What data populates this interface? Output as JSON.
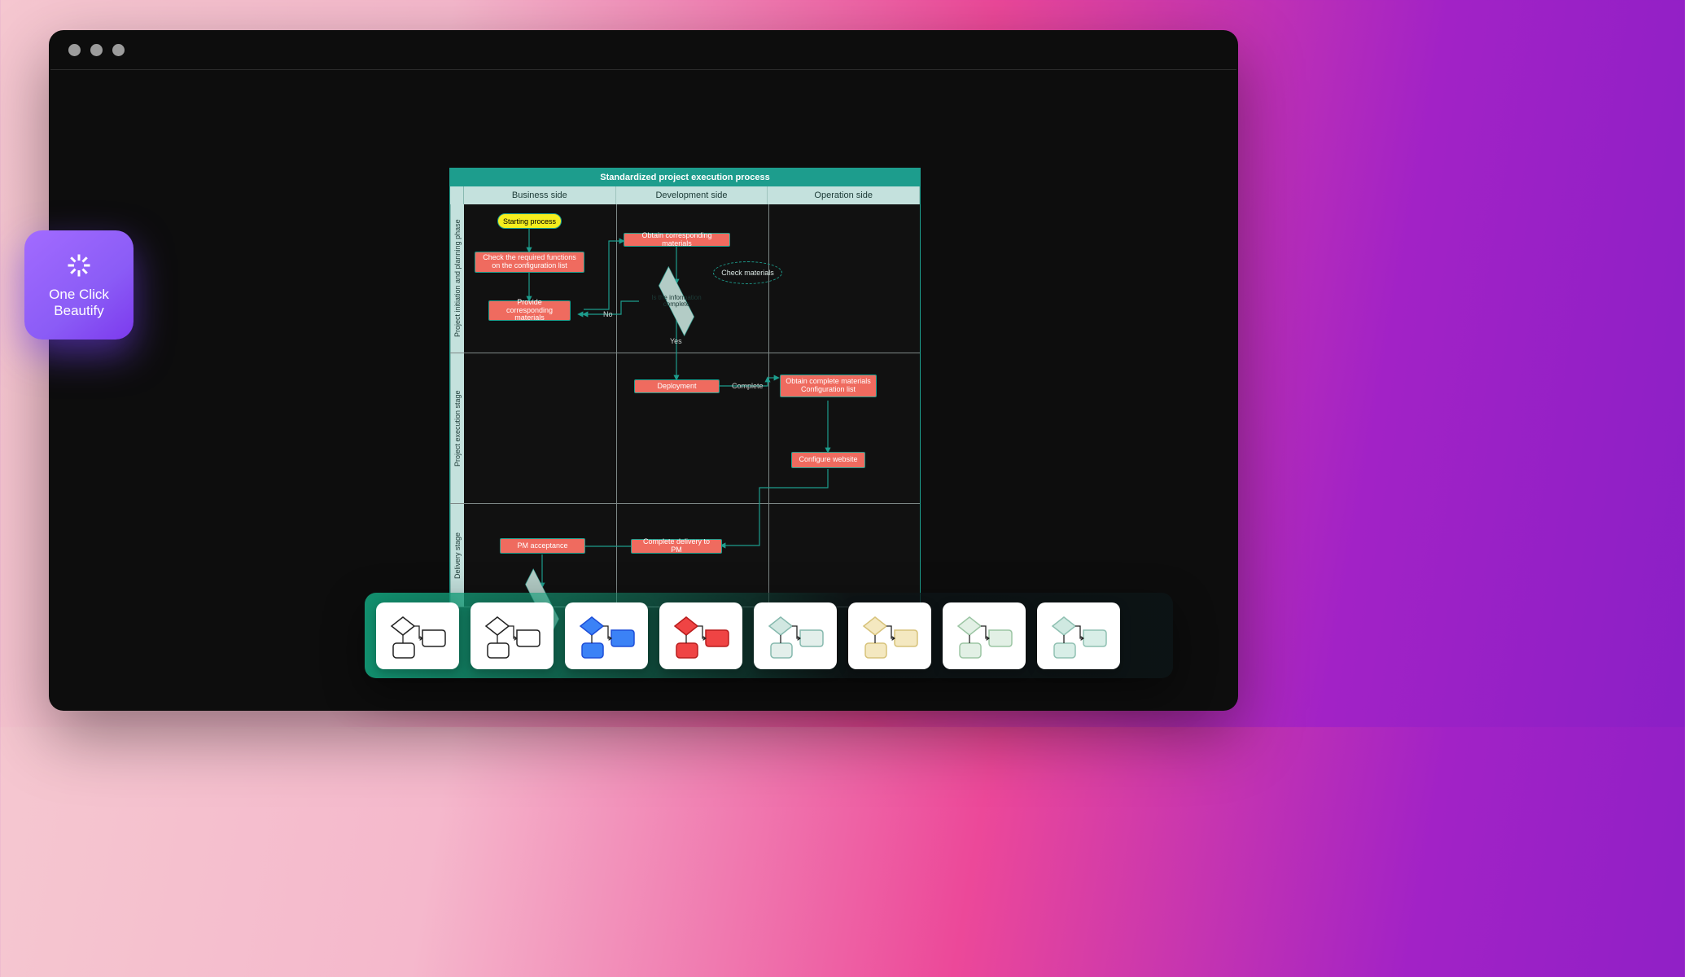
{
  "badge": {
    "line1": "One Click",
    "line2": "Beautify"
  },
  "chart": {
    "title": "Standardized project execution process",
    "columns": [
      "Business side",
      "Development side",
      "Operation side"
    ],
    "lanes": [
      "Project initiation and planning phase",
      "Project execution stage",
      "Delivery stage"
    ],
    "nodes": {
      "start": "Starting process",
      "check_funcs": "Check the required functions on the configuration list",
      "provide_materials": "Provide corresponding materials",
      "obtain_materials": "Obtain corresponding materials",
      "decision": "Is the information complete",
      "check_materials": "Check materials",
      "deployment": "Deployment",
      "obtain_complete": "Obtain complete materials Configuration list",
      "configure_site": "Configure website",
      "complete_delivery": "Complete delivery to PM",
      "pm_acceptance": "PM acceptance"
    },
    "edges": {
      "no": "No",
      "yes": "Yes",
      "complete": "Complete"
    }
  },
  "styles": [
    {
      "name": "style-outline-white",
      "diamond_fill": "#ffffff",
      "diamond_stroke": "#222",
      "box_fill": "#ffffff",
      "box_stroke": "#222"
    },
    {
      "name": "style-outline-black",
      "diamond_fill": "#ffffff",
      "diamond_stroke": "#222",
      "box_fill": "#ffffff",
      "box_stroke": "#222"
    },
    {
      "name": "style-blue",
      "diamond_fill": "#3b82f6",
      "diamond_stroke": "#1d4ed8",
      "box_fill": "#3b82f6",
      "box_stroke": "#1d4ed8"
    },
    {
      "name": "style-red",
      "diamond_fill": "#ef4444",
      "diamond_stroke": "#b91c1c",
      "box_fill": "#ef4444",
      "box_stroke": "#b91c1c"
    },
    {
      "name": "style-mint",
      "diamond_fill": "#d1e7e1",
      "diamond_stroke": "#86b9ae",
      "box_fill": "#e3efeb",
      "box_stroke": "#86b9ae"
    },
    {
      "name": "style-cream",
      "diamond_fill": "#f4e8c0",
      "diamond_stroke": "#d7c27a",
      "box_fill": "#f4e8c0",
      "box_stroke": "#d7c27a"
    },
    {
      "name": "style-pale-green",
      "diamond_fill": "#e2f0e5",
      "diamond_stroke": "#9cc5a4",
      "box_fill": "#e2f0e5",
      "box_stroke": "#9cc5a4"
    },
    {
      "name": "style-seafoam",
      "diamond_fill": "#cfe9e1",
      "diamond_stroke": "#8fc0b2",
      "box_fill": "#d8eee7",
      "box_stroke": "#8fc0b2"
    }
  ]
}
